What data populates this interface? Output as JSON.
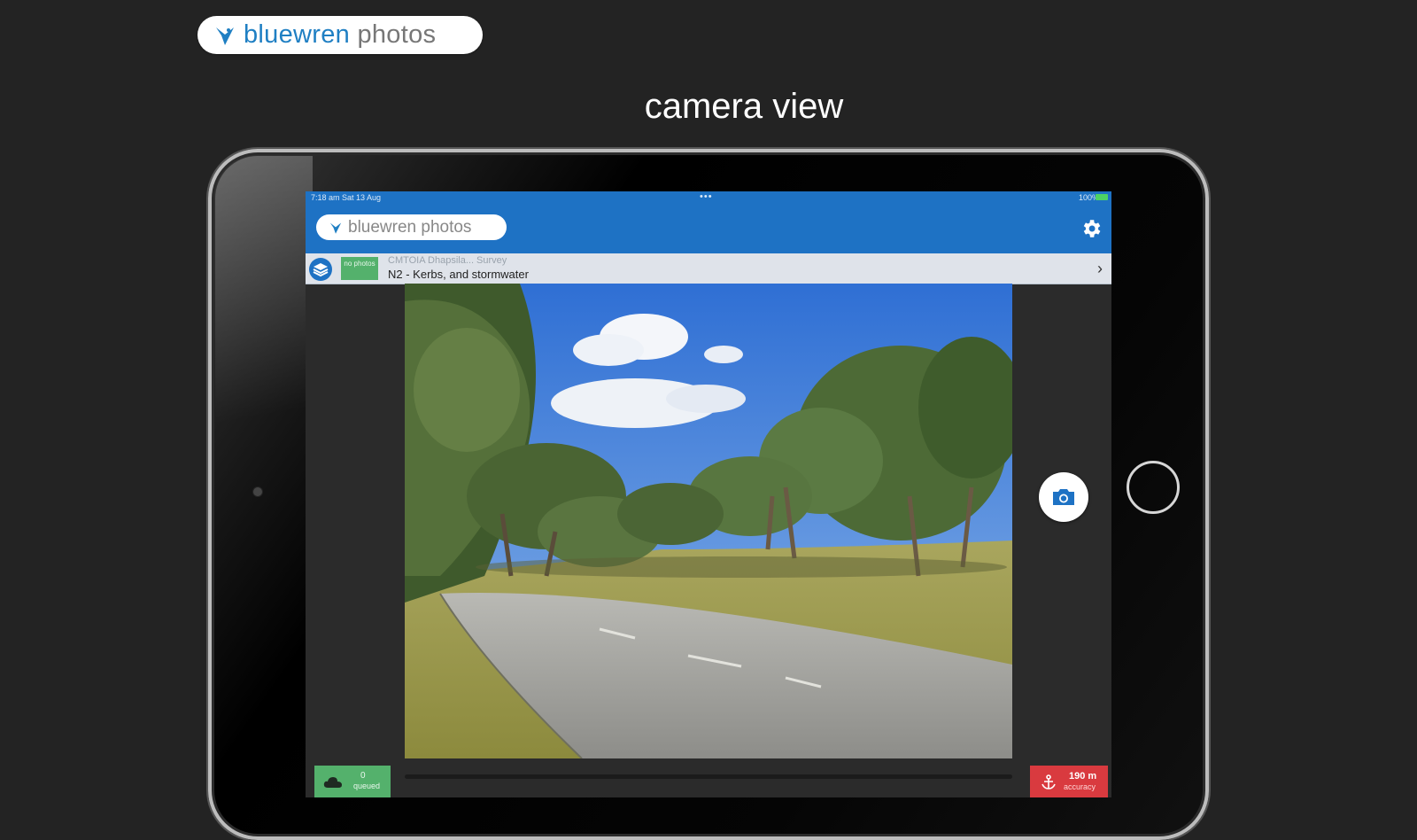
{
  "promo": {
    "brand_prefix": "bluewren",
    "brand_suffix": " photos",
    "headline": "camera view"
  },
  "device": {
    "status_time": "7:18 am  Sat 13 Aug",
    "status_right": "100%",
    "status_dots": "•••"
  },
  "app": {
    "brand": "bluewren photos",
    "settings_icon": "gear-icon",
    "header_color": "#1e72c4"
  },
  "info_bar": {
    "photo_badge": "no photos",
    "survey": "CMTOIA Dhapsila... Survey",
    "category": "N2 - Kerbs, and stormwater"
  },
  "camera": {
    "capture_icon": "camera-icon"
  },
  "bottom": {
    "queue_count": "0",
    "queue_label": "queued",
    "accuracy_value": "190 m",
    "accuracy_label": "accuracy",
    "queue_color": "#54b16c",
    "accuracy_color": "#d93a3f"
  }
}
